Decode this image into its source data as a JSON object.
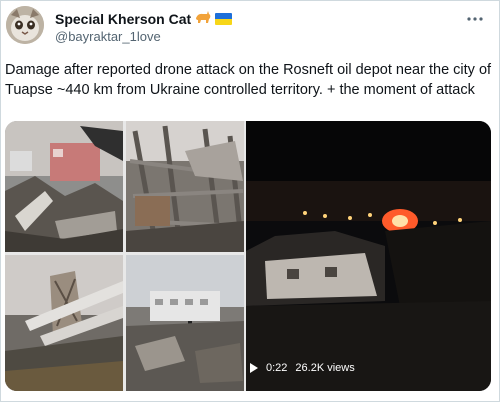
{
  "tweet": {
    "author_name": "Special Kherson Cat",
    "author_handle": "@bayraktar_1love",
    "text": "Damage after reported drone attack on the Rosneft oil depot near the city of Tuapse ~440 km from Ukraine controlled territory. + the moment of attack",
    "more_icon": "ellipsis-icon",
    "name_emojis": [
      "cat-emoji-icon",
      "ukraine-flag-icon"
    ]
  },
  "video": {
    "time": "0:22",
    "views": "26.2K views",
    "play_icon": "play-icon"
  },
  "colors": {
    "text": "#0f1419",
    "secondary": "#536471",
    "border": "#cfd9de"
  }
}
